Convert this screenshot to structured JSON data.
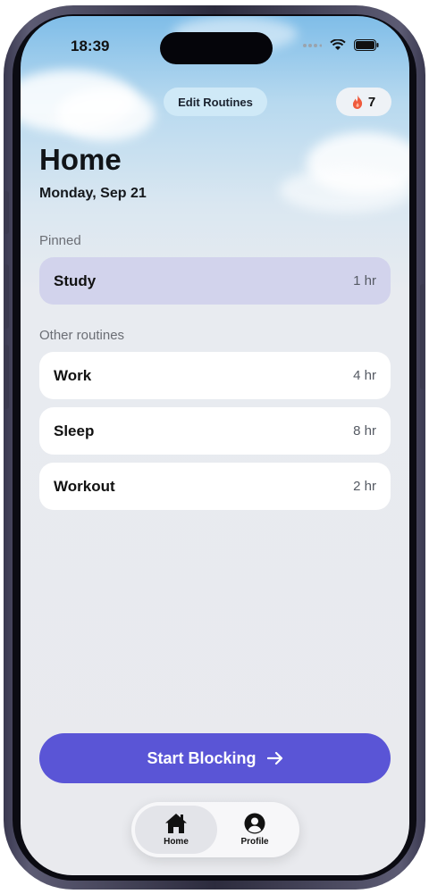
{
  "status_bar": {
    "time": "18:39"
  },
  "header": {
    "edit_button": "Edit Routines",
    "streak_count": "7"
  },
  "page": {
    "title": "Home",
    "date": "Monday, Sep 21"
  },
  "pinned": {
    "label": "Pinned",
    "items": [
      {
        "name": "Study",
        "duration": "1 hr"
      }
    ]
  },
  "others": {
    "label": "Other routines",
    "items": [
      {
        "name": "Work",
        "duration": "4 hr"
      },
      {
        "name": "Sleep",
        "duration": "8 hr"
      },
      {
        "name": "Workout",
        "duration": "2 hr"
      }
    ]
  },
  "cta": {
    "label": "Start Blocking",
    "icon": "arrow-right-icon"
  },
  "tabs": [
    {
      "label": "Home",
      "icon": "home-icon",
      "active": true
    },
    {
      "label": "Profile",
      "icon": "profile-icon",
      "active": false
    }
  ],
  "colors": {
    "accent": "#5a55d6",
    "pinned_bg": "#d2d3ec",
    "edit_bg": "#cfe9f7",
    "flame": "#ef5a3c"
  }
}
